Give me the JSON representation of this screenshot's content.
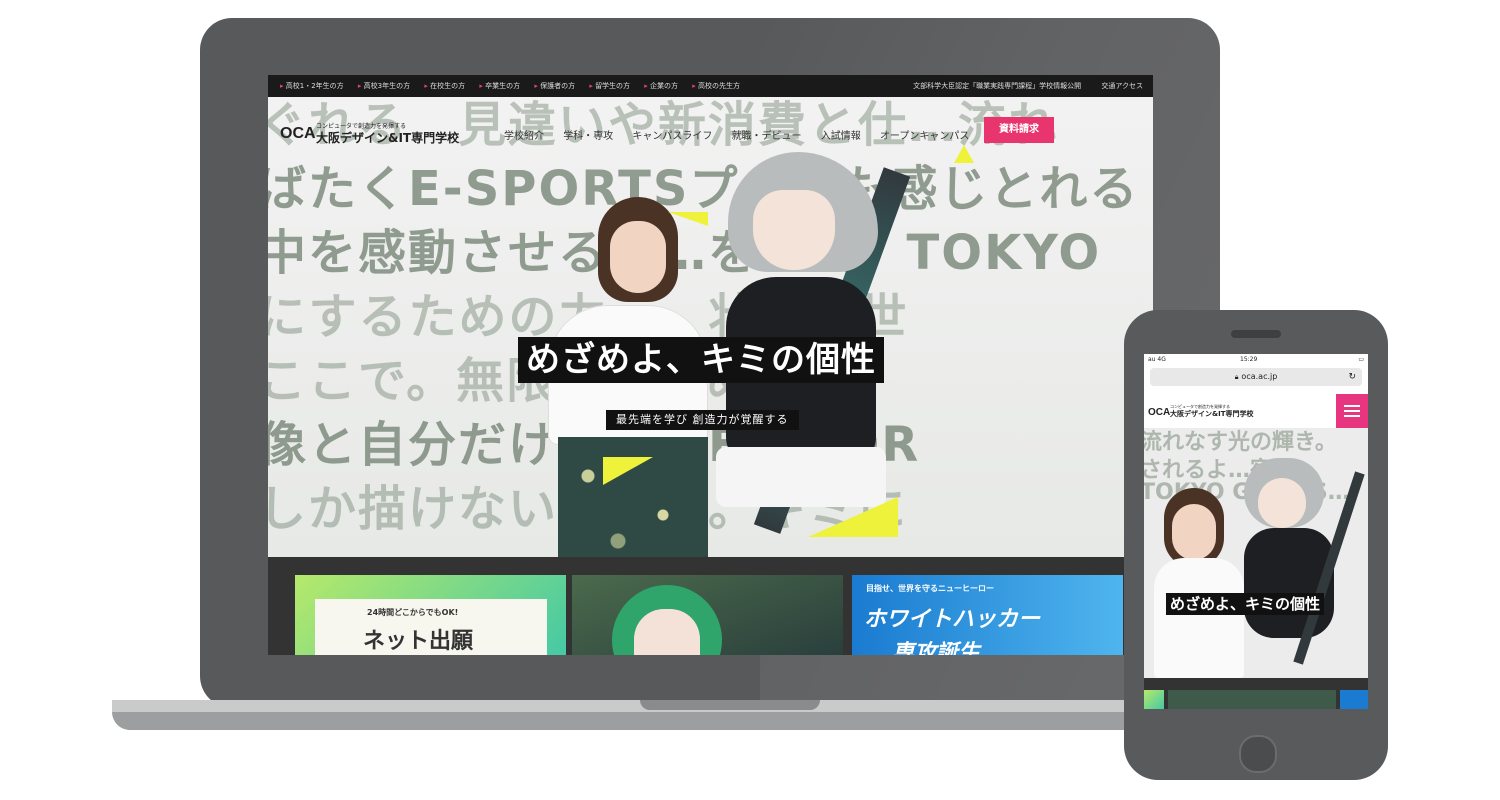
{
  "utility_bar": {
    "audience_links": [
      "高校1・2年生の方",
      "高校3年生の方",
      "在校生の方",
      "卒業生の方",
      "保護者の方",
      "留学生の方",
      "企業の方",
      "高校の先生方"
    ],
    "right_links": [
      "文部科学大臣認定「職業実践専門課程」学校情報公開",
      "交通アクセス"
    ]
  },
  "logo": {
    "mark": "OCA",
    "tagline": "コンピュータで創造力を発揮する",
    "name": "大阪デザイン&IT専門学校"
  },
  "nav": {
    "items": [
      "学校紹介",
      "学科・専攻",
      "キャンパスライフ",
      "就職・デビュー",
      "入試情報",
      "オープンキャンパス"
    ],
    "cta": "資料請求",
    "cta_color": "#e8356d"
  },
  "hero": {
    "background_lines": [
      "ぐれる　見違いや新消費と仕…流れ",
      "ばたくE-SPORTSプ…でも感じとれる",
      "中を感動させる治…を…て。TOKYO",
      "にするための力…。壮大な世",
      "ここで。無限…めざめよ、",
      "像と自分だけ…したE-SPOR",
      "しか描けない…個性。キミに"
    ],
    "headline": "めざめよ、キミの個性",
    "subline": "最先端を学び 創造力が覚醒する"
  },
  "banners": {
    "net_application_small": "24時間どこからでもOK!",
    "net_application_big": "ネット出願",
    "hacker_small": "目指せ、世界を守るニューヒーロー",
    "hacker_big": "ホワイトハッカー",
    "hacker_big2": "専攻誕生"
  },
  "phone": {
    "status_left": "au 4G",
    "status_time": "15:29",
    "url": "oca.ac.jp",
    "menu_color": "#e8357f",
    "background_lines": [
      "流れなす光の輝き。",
      "されるよ…宿り…",
      "TOKYO GAME S…",
      "…",
      "…"
    ]
  },
  "colors": {
    "device_body": "#58595b",
    "accent_pink": "#e8356d"
  }
}
